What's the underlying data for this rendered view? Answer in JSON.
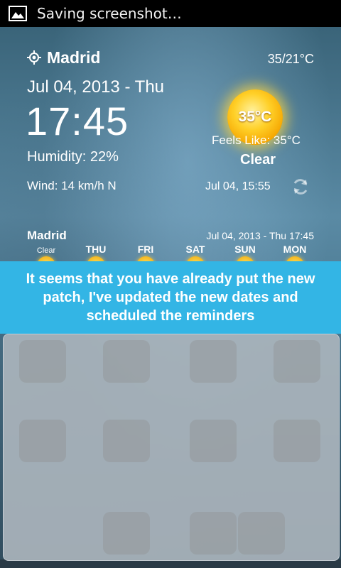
{
  "status_bar": {
    "notification_text": "Saving screenshot…",
    "icon": "image-icon"
  },
  "weather": {
    "city": "Madrid",
    "temp_range": "35/21°C",
    "date": "Jul 04, 2013 - Thu",
    "time": "17:45",
    "humidity": "Humidity: 22%",
    "wind": "Wind: 14 km/h N",
    "current_temp": "35°C",
    "feels_like": "Feels Like: 35°C",
    "condition": "Clear",
    "last_updated": "Jul 04, 15:55",
    "icons": {
      "location": "location-icon",
      "refresh": "refresh-icon",
      "condition": "sun-icon"
    }
  },
  "forecast": {
    "city": "Madrid",
    "datetime": "Jul 04, 2013 - Thu 17:45",
    "days": [
      {
        "label": "Clear"
      },
      {
        "label": "THU"
      },
      {
        "label": "FRI"
      },
      {
        "label": "SAT"
      },
      {
        "label": "SUN"
      },
      {
        "label": "MON"
      }
    ]
  },
  "toast": {
    "message": "It seems that you have already put the new patch, I've updated the new  dates and scheduled the reminders",
    "color": "#33b5e5"
  }
}
